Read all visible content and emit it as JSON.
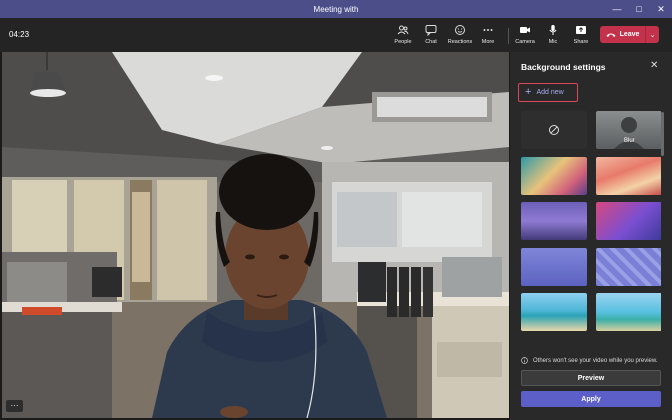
{
  "window": {
    "title": "Meeting with"
  },
  "toolbar": {
    "timer": "04:23",
    "buttons": [
      {
        "label": "People",
        "icon": "people-icon"
      },
      {
        "label": "Chat",
        "icon": "chat-icon"
      },
      {
        "label": "Reactions",
        "icon": "reactions-icon"
      },
      {
        "label": "More",
        "icon": "more-icon"
      },
      {
        "label": "Camera",
        "icon": "camera-icon"
      },
      {
        "label": "Mic",
        "icon": "mic-icon"
      },
      {
        "label": "Share",
        "icon": "share-icon"
      }
    ],
    "leave_label": "Leave",
    "leave_color": "#c4314b"
  },
  "panel": {
    "title": "Background settings",
    "add_new_label": "Add new",
    "blur_label": "Blur",
    "notice": "Others won't see your video while you preview.",
    "preview_label": "Preview",
    "apply_label": "Apply",
    "accent_color": "#5b5fc7"
  },
  "video": {
    "more_label": "···"
  }
}
